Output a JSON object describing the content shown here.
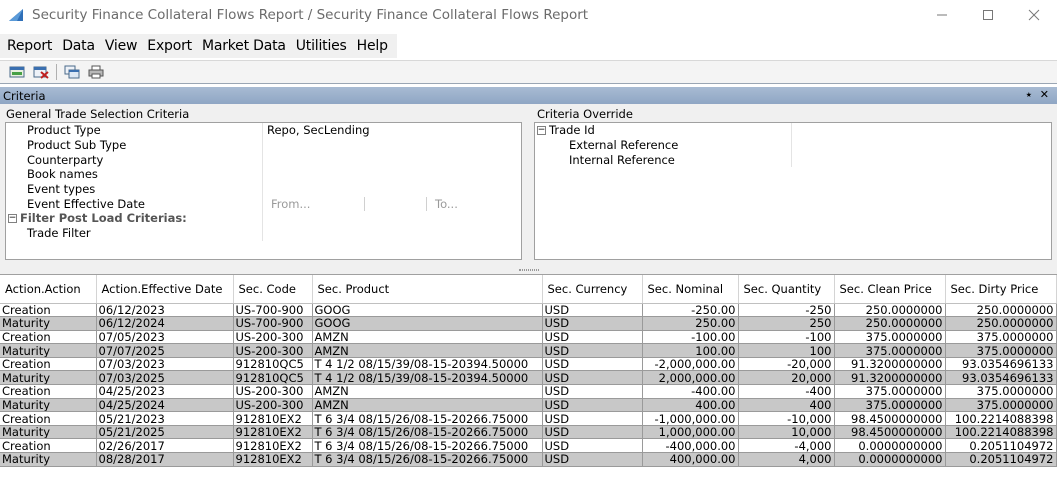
{
  "window": {
    "title": "Security Finance Collateral Flows Report / Security Finance Collateral Flows Report",
    "minimize_icon": "minimize-icon",
    "maximize_icon": "maximize-icon",
    "close_icon": "close-icon"
  },
  "menu": {
    "items": [
      "Report",
      "Data",
      "View",
      "Export",
      "Market Data",
      "Utilities",
      "Help"
    ]
  },
  "toolbar": {
    "icons": [
      "load-icon",
      "clear-icon",
      "copy-icon",
      "print-icon"
    ]
  },
  "criteria": {
    "header": "Criteria",
    "pin_glyph": "⭑",
    "close_glyph": "✕",
    "general": {
      "title": "General Trade Selection Criteria",
      "rows": [
        {
          "name": "Product Type",
          "value": "Repo, SecLending"
        },
        {
          "name": "Product Sub Type",
          "value": ""
        },
        {
          "name": "Counterparty",
          "value": ""
        },
        {
          "name": "Book names",
          "value": ""
        },
        {
          "name": "Event types",
          "value": ""
        }
      ],
      "date_row": {
        "name": "Event Effective Date",
        "from": "From...",
        "to": "To..."
      },
      "filter_category": "Filter Post Load Criterias:",
      "filter_rows": [
        {
          "name": "Trade Filter",
          "value": ""
        }
      ]
    },
    "override": {
      "title": "Criteria Override",
      "category": "Trade Id",
      "rows": [
        {
          "name": "External Reference"
        },
        {
          "name": "Internal Reference"
        }
      ]
    }
  },
  "table": {
    "columns": [
      "Action.Action",
      "Action.Effective Date",
      "Sec. Code",
      "Sec. Product",
      "Sec. Currency",
      "Sec. Nominal",
      "Sec. Quantity",
      "Sec. Clean Price",
      "Sec. Dirty Price"
    ],
    "rows": [
      [
        "Creation",
        "06/12/2023",
        "US-700-900",
        "GOOG",
        "USD",
        "-250.00",
        "-250",
        "250.0000000",
        "250.0000000"
      ],
      [
        "Maturity",
        "06/12/2024",
        "US-700-900",
        "GOOG",
        "USD",
        "250.00",
        "250",
        "250.0000000",
        "250.0000000"
      ],
      [
        "Creation",
        "07/05/2023",
        "US-200-300",
        "AMZN",
        "USD",
        "-100.00",
        "-100",
        "375.0000000",
        "375.0000000"
      ],
      [
        "Maturity",
        "07/07/2025",
        "US-200-300",
        "AMZN",
        "USD",
        "100.00",
        "100",
        "375.0000000",
        "375.0000000"
      ],
      [
        "Creation",
        "07/03/2023",
        "912810QC5",
        "T 4 1/2 08/15/39/08-15-20394.50000",
        "USD",
        "-2,000,000.00",
        "-20,000",
        "91.3200000000",
        "93.0354696133"
      ],
      [
        "Maturity",
        "07/03/2025",
        "912810QC5",
        "T 4 1/2 08/15/39/08-15-20394.50000",
        "USD",
        "2,000,000.00",
        "20,000",
        "91.3200000000",
        "93.0354696133"
      ],
      [
        "Creation",
        "04/25/2023",
        "US-200-300",
        "AMZN",
        "USD",
        "-400.00",
        "-400",
        "375.0000000",
        "375.0000000"
      ],
      [
        "Maturity",
        "04/25/2024",
        "US-200-300",
        "AMZN",
        "USD",
        "400.00",
        "400",
        "375.0000000",
        "375.0000000"
      ],
      [
        "Creation",
        "05/21/2023",
        "912810EX2",
        "T 6 3/4 08/15/26/08-15-20266.75000",
        "USD",
        "-1,000,000.00",
        "-10,000",
        "98.4500000000",
        "100.2214088398"
      ],
      [
        "Maturity",
        "05/21/2025",
        "912810EX2",
        "T 6 3/4 08/15/26/08-15-20266.75000",
        "USD",
        "1,000,000.00",
        "10,000",
        "98.4500000000",
        "100.2214088398"
      ],
      [
        "Creation",
        "02/26/2017",
        "912810EX2",
        "T 6 3/4 08/15/26/08-15-20266.75000",
        "USD",
        "-400,000.00",
        "-4,000",
        "0.0000000000",
        "0.2051104972"
      ],
      [
        "Maturity",
        "08/28/2017",
        "912810EX2",
        "T 6 3/4 08/15/26/08-15-20266.75000",
        "USD",
        "400,000.00",
        "4,000",
        "0.0000000000",
        "0.2051104972"
      ]
    ]
  }
}
